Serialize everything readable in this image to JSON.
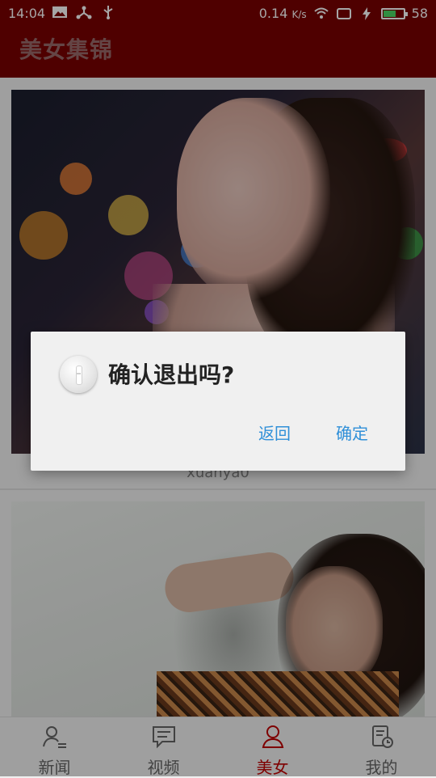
{
  "status_bar": {
    "time": "14:04",
    "speed": "0.14",
    "speed_unit": "K/s",
    "battery_level": "58"
  },
  "app_bar": {
    "title": "美女集锦"
  },
  "feed": {
    "items": [
      {
        "caption": "xuanya0"
      }
    ]
  },
  "bottom_nav": {
    "items": [
      {
        "label": "新闻",
        "icon": "person-list-icon"
      },
      {
        "label": "视频",
        "icon": "chat-bubble-icon"
      },
      {
        "label": "美女",
        "icon": "person-icon",
        "active": true
      },
      {
        "label": "我的",
        "icon": "clipboard-clock-icon"
      }
    ]
  },
  "dialog": {
    "title": "确认退出吗?",
    "back_label": "返回",
    "ok_label": "确定"
  },
  "colors": {
    "app_bar": "#7a0000",
    "accent": "#c20000",
    "dialog_button": "#2f8fd8"
  }
}
